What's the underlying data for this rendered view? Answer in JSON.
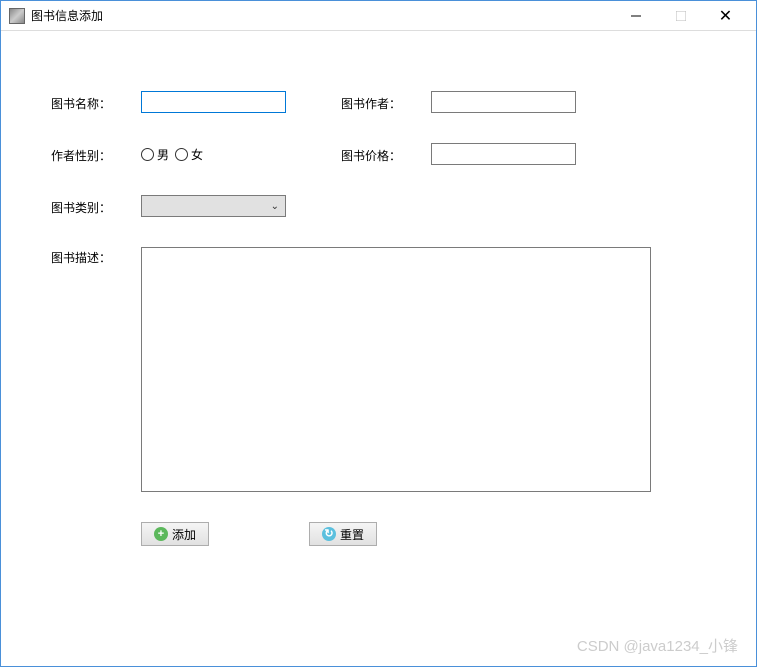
{
  "window": {
    "title": "图书信息添加"
  },
  "form": {
    "name_label": "图书名称：",
    "name_value": "",
    "author_label": "图书作者：",
    "author_value": "",
    "gender_label": "作者性别：",
    "gender_male": "男",
    "gender_female": "女",
    "price_label": "图书价格：",
    "price_value": "",
    "category_label": "图书类别：",
    "category_value": "",
    "desc_label": "图书描述：",
    "desc_value": ""
  },
  "buttons": {
    "add_label": "添加",
    "reset_label": "重置"
  },
  "watermark": "CSDN @java1234_小锋"
}
